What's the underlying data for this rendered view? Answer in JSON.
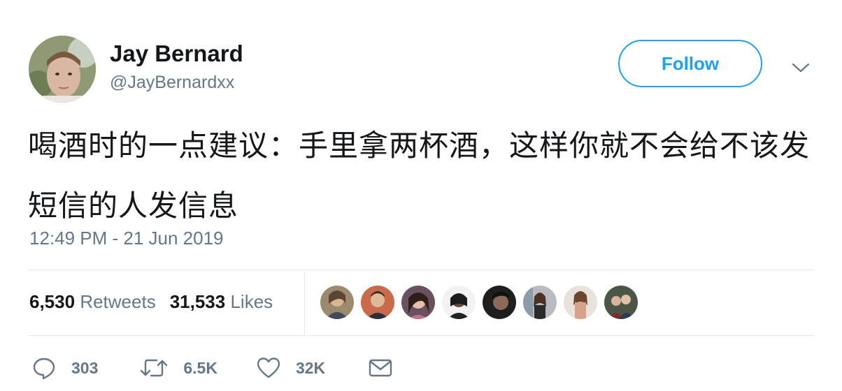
{
  "author": {
    "display_name": "Jay Bernard",
    "handle": "@JayBernardxx"
  },
  "follow_label": "Follow",
  "tweet": {
    "text": "喝酒时的一点建议：手里拿两杯酒，这样你就不会给不该发短信的人发信息",
    "timestamp": "12:49 PM - 21 Jun 2019"
  },
  "stats": {
    "retweets_count": "6,530",
    "retweets_label": "Retweets",
    "likes_count": "31,533",
    "likes_label": "Likes"
  },
  "actions": {
    "reply_count": "303",
    "retweet_count": "6.5K",
    "like_count": "32K"
  },
  "colors": {
    "accent": "#1da1f2",
    "text": "#14171a",
    "muted": "#657786",
    "divider": "#e1e8ed"
  },
  "icons": {
    "more": "chevron-down-icon",
    "reply": "reply-icon",
    "retweet": "retweet-icon",
    "like": "heart-icon",
    "message": "envelope-icon"
  }
}
